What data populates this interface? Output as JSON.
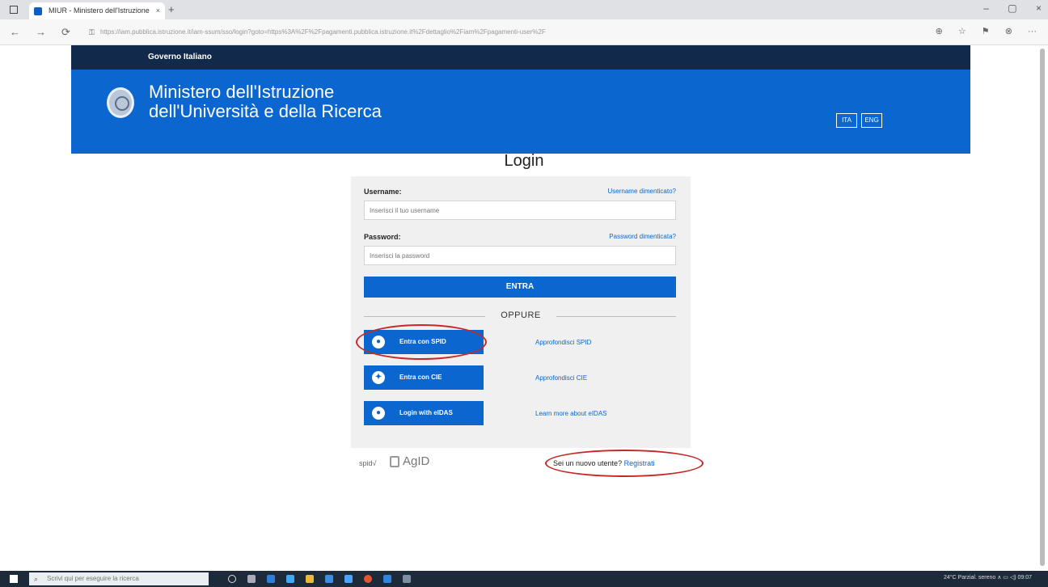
{
  "browser": {
    "tab_title": "MIUR - Ministero dell'Istruzione",
    "tab_close": "×",
    "tab_new": "+",
    "url": "https://iam.pubblica.istruzione.it/iam-ssum/sso/login?goto=https%3A%2F%2Fpagamenti.pubblica.istruzione.it%2Fdettaglio%2Fiam%2Fpagamenti-user%2F",
    "nav": {
      "back": "←",
      "forward": "→",
      "refresh": "⟳"
    },
    "window": {
      "minimize": "–",
      "maximize": "▢",
      "close": "×"
    },
    "tools": [
      "⊕",
      "☆",
      "⚑",
      "⊗",
      "···"
    ]
  },
  "gov": {
    "label": "Governo Italiano"
  },
  "ministry": {
    "line1": "Ministero dell'Istruzione",
    "line2": "dell'Università e della Ricerca"
  },
  "lang": {
    "it": "ITA",
    "en": "ENG"
  },
  "login": {
    "title": "Login",
    "username_label": "Username:",
    "username_forgot": "Username dimenticato?",
    "username_placeholder": "Inserisci il tuo username",
    "password_label": "Password:",
    "password_forgot": "Password dimenticata?",
    "password_placeholder": "Inserisci la password",
    "submit": "ENTRA",
    "oppure": "OPPURE"
  },
  "identity": [
    {
      "label": "Entra con SPID",
      "link": "Approfondisci SPID"
    },
    {
      "label": "Entra con CIE",
      "link": "Approfondisci CIE"
    },
    {
      "label": "Login with eIDAS",
      "link": "Learn more about eIDAS"
    }
  ],
  "footer": {
    "spid": "spid√",
    "agid": "AgID",
    "new_user_q": "Sei un nuovo utente?",
    "register": "Registrati"
  },
  "taskbar": {
    "search_placeholder": "Scrivi qui per eseguire la ricerca",
    "tray": "24°C Parzial. sereno   ∧  ▭ ◁)   09:07"
  },
  "colors": {
    "gov_dark": "#11294b",
    "brand_blue": "#0b66cf",
    "annotation_red": "#c62828"
  }
}
